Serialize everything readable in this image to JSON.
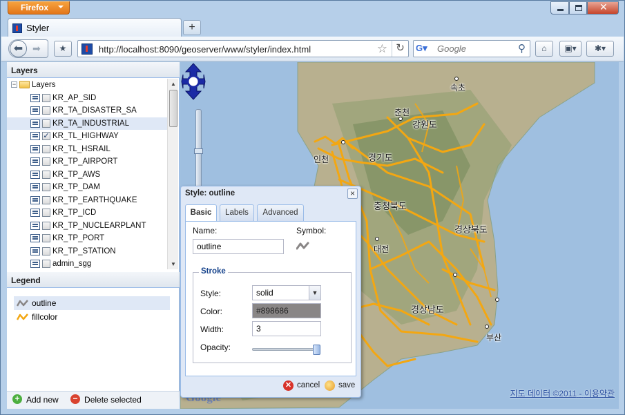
{
  "browser": {
    "app_button": "Firefox",
    "tab_title": "Styler",
    "url": "http://localhost:8090/geoserver/www/styler/index.html",
    "search_placeholder": "Google",
    "search_engine_icon": "google-g-icon"
  },
  "layers_panel": {
    "title": "Layers",
    "root_label": "Layers",
    "items": [
      {
        "label": "KR_AP_SID",
        "checked": false,
        "selected": false
      },
      {
        "label": "KR_TA_DISASTER_SA",
        "checked": false,
        "selected": false
      },
      {
        "label": "KR_TA_INDUSTRIAL",
        "checked": false,
        "selected": true
      },
      {
        "label": "KR_TL_HIGHWAY",
        "checked": true,
        "selected": false
      },
      {
        "label": "KR_TL_HSRAIL",
        "checked": false,
        "selected": false
      },
      {
        "label": "KR_TP_AIRPORT",
        "checked": false,
        "selected": false
      },
      {
        "label": "KR_TP_AWS",
        "checked": false,
        "selected": false
      },
      {
        "label": "KR_TP_DAM",
        "checked": false,
        "selected": false
      },
      {
        "label": "KR_TP_EARTHQUAKE",
        "checked": false,
        "selected": false
      },
      {
        "label": "KR_TP_ICD",
        "checked": false,
        "selected": false
      },
      {
        "label": "KR_TP_NUCLEARPLANT",
        "checked": false,
        "selected": false
      },
      {
        "label": "KR_TP_PORT",
        "checked": false,
        "selected": false
      },
      {
        "label": "KR_TP_STATION",
        "checked": false,
        "selected": false
      },
      {
        "label": "admin_sgg",
        "checked": false,
        "selected": false
      }
    ]
  },
  "legend_panel": {
    "title": "Legend",
    "items": [
      {
        "label": "outline",
        "color": "#898686",
        "selected": true
      },
      {
        "label": "fillcolor",
        "color": "#f3a712",
        "selected": false
      }
    ],
    "add_label": "Add new",
    "delete_label": "Delete selected"
  },
  "map": {
    "place_names": [
      "속초",
      "춘천",
      "강원도",
      "인천",
      "경기도",
      "충청북도",
      "경상북도",
      "대전",
      "경상남도",
      "부산"
    ],
    "copyright_text": "지도 데이터 ©2011",
    "terms_text": "이용약관",
    "separator": "-",
    "logo_text": "Google",
    "road_color": "#f3a712"
  },
  "style_dialog": {
    "title": "Style: outline",
    "tabs": [
      "Basic",
      "Labels",
      "Advanced"
    ],
    "active_tab": "Basic",
    "name_label": "Name:",
    "name_value": "outline",
    "symbol_label": "Symbol:",
    "stroke_legend": "Stroke",
    "style_label": "Style:",
    "style_value": "solid",
    "color_label": "Color:",
    "color_value": "#898686",
    "width_label": "Width:",
    "width_value": "3",
    "opacity_label": "Opacity:",
    "opacity_value": 1.0,
    "cancel_label": "cancel",
    "save_label": "save"
  }
}
